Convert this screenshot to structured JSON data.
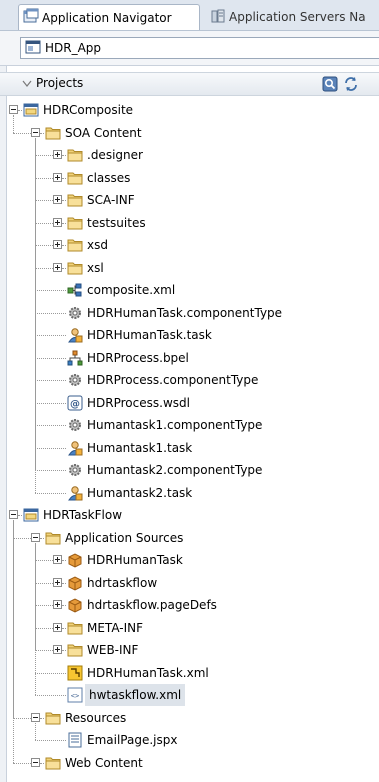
{
  "tabs": [
    {
      "label": "Application Navigator",
      "icon": "application-navigator-icon",
      "active": true
    },
    {
      "label": "Application Servers Na",
      "icon": "application-servers-icon",
      "active": false
    }
  ],
  "app_selector": {
    "value": "HDR_App",
    "icon": "application-icon"
  },
  "panel": {
    "title": "Projects",
    "icons": [
      "filter-icon",
      "sync-icon"
    ]
  },
  "tree": [
    {
      "label": "HDRComposite",
      "level": 0,
      "icon": "project",
      "expander": "minus"
    },
    {
      "label": "SOA Content",
      "level": 1,
      "icon": "folder",
      "expander": "minus"
    },
    {
      "label": ".designer",
      "level": 2,
      "icon": "folder",
      "expander": "plus"
    },
    {
      "label": "classes",
      "level": 2,
      "icon": "folder",
      "expander": "plus"
    },
    {
      "label": "SCA-INF",
      "level": 2,
      "icon": "folder",
      "expander": "plus"
    },
    {
      "label": "testsuites",
      "level": 2,
      "icon": "folder",
      "expander": "plus"
    },
    {
      "label": "xsd",
      "level": 2,
      "icon": "folder",
      "expander": "plus"
    },
    {
      "label": "xsl",
      "level": 2,
      "icon": "folder",
      "expander": "plus"
    },
    {
      "label": "composite.xml",
      "level": 2,
      "icon": "composite"
    },
    {
      "label": "HDRHumanTask.componentType",
      "level": 2,
      "icon": "gear"
    },
    {
      "label": "HDRHumanTask.task",
      "level": 2,
      "icon": "task"
    },
    {
      "label": "HDRProcess.bpel",
      "level": 2,
      "icon": "bpel"
    },
    {
      "label": "HDRProcess.componentType",
      "level": 2,
      "icon": "gear"
    },
    {
      "label": "HDRProcess.wsdl",
      "level": 2,
      "icon": "wsdl"
    },
    {
      "label": "Humantask1.componentType",
      "level": 2,
      "icon": "gear"
    },
    {
      "label": "Humantask1.task",
      "level": 2,
      "icon": "task"
    },
    {
      "label": "Humantask2.componentType",
      "level": 2,
      "icon": "gear"
    },
    {
      "label": "Humantask2.task",
      "level": 2,
      "icon": "task"
    },
    {
      "label": "HDRTaskFlow",
      "level": 0,
      "icon": "project",
      "expander": "minus"
    },
    {
      "label": "Application Sources",
      "level": 1,
      "icon": "folder",
      "expander": "minus"
    },
    {
      "label": "HDRHumanTask",
      "level": 2,
      "icon": "package",
      "expander": "plus"
    },
    {
      "label": "hdrtaskflow",
      "level": 2,
      "icon": "package",
      "expander": "plus"
    },
    {
      "label": "hdrtaskflow.pageDefs",
      "level": 2,
      "icon": "package",
      "expander": "plus"
    },
    {
      "label": "META-INF",
      "level": 2,
      "icon": "folder",
      "expander": "plus"
    },
    {
      "label": "WEB-INF",
      "level": 2,
      "icon": "folder",
      "expander": "plus"
    },
    {
      "label": "HDRHumanTask.xml",
      "level": 2,
      "icon": "taskflow"
    },
    {
      "label": "hwtaskflow.xml",
      "level": 2,
      "icon": "xml",
      "selected": true
    },
    {
      "label": "Resources",
      "level": 1,
      "icon": "folder",
      "expander": "minus"
    },
    {
      "label": "EmailPage.jspx",
      "level": 2,
      "icon": "jspx"
    },
    {
      "label": "Web Content",
      "level": 1,
      "icon": "folder",
      "expander": "minus"
    }
  ]
}
